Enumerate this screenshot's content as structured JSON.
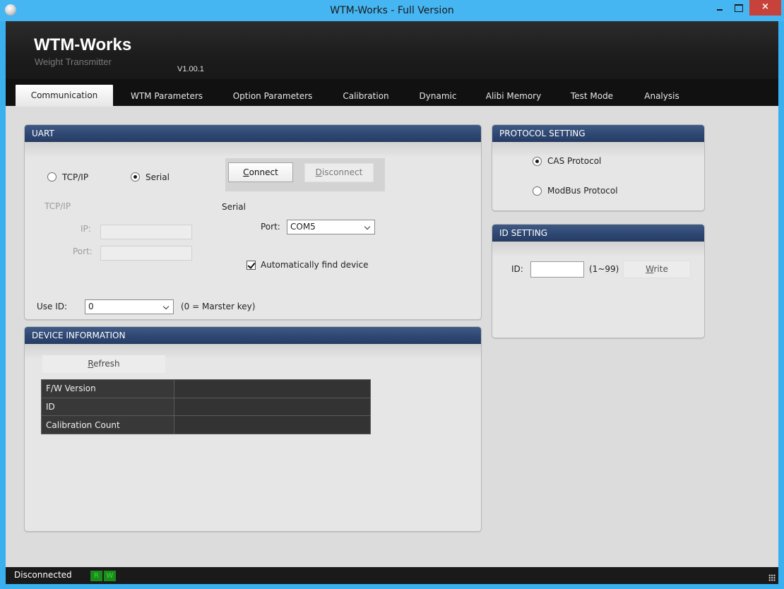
{
  "window": {
    "title": "WTM-Works - Full Version",
    "close_glyph": "×",
    "app_icon": "app-orb-icon"
  },
  "header": {
    "brand": "WTM-Works",
    "subtitle": "Weight Transmitter",
    "version": "V1.00.1"
  },
  "tabs": [
    {
      "label": "Communication",
      "active": true
    },
    {
      "label": "WTM Parameters",
      "active": false
    },
    {
      "label": "Option Parameters",
      "active": false
    },
    {
      "label": "Calibration",
      "active": false
    },
    {
      "label": "Dynamic",
      "active": false
    },
    {
      "label": "Alibi Memory",
      "active": false
    },
    {
      "label": "Test Mode",
      "active": false
    },
    {
      "label": "Analysis",
      "active": false
    }
  ],
  "uart": {
    "title": "UART",
    "tcpip_radio": "TCP/IP",
    "serial_radio": "Serial",
    "selected_mode": "Serial",
    "connect_button": {
      "first": "C",
      "rest": "onnect"
    },
    "disconnect_button": {
      "first": "D",
      "rest": "isconnect"
    },
    "tcpip_section": "TCP/IP",
    "ip_label": "IP:",
    "ip_value": "",
    "port_label": "Port:",
    "port_value": "",
    "serial_section": "Serial",
    "serial_port_label": "Port:",
    "serial_port_value": "COM5",
    "auto_find_label": "Automatically find device",
    "auto_find_checked": true,
    "use_id_label": "Use ID:",
    "use_id_value": "0",
    "use_id_note": "(0 = Marster key)"
  },
  "device_info": {
    "title": "DEVICE INFORMATION",
    "refresh_button": {
      "first": "R",
      "rest": "efresh"
    },
    "rows": [
      {
        "key": "F/W Version",
        "value": ""
      },
      {
        "key": "ID",
        "value": ""
      },
      {
        "key": "Calibration Count",
        "value": ""
      }
    ]
  },
  "protocol": {
    "title": "PROTOCOL SETTING",
    "options": [
      "CAS Protocol",
      "ModBus Protocol"
    ],
    "selected": "CAS Protocol"
  },
  "id_setting": {
    "title": "ID SETTING",
    "id_label": "ID:",
    "id_value": "",
    "range": "(1~99)",
    "write_button": {
      "first": "W",
      "rest": "rite"
    }
  },
  "status": {
    "text": "Disconnected",
    "led_r": "R",
    "led_w": "W"
  },
  "colors": {
    "title_bar": "#46b6f3",
    "panel_header": "#2e4772",
    "header_bg": "#1c1c1c",
    "close_button": "#c7423a",
    "led_green": "#1a8a1a"
  }
}
